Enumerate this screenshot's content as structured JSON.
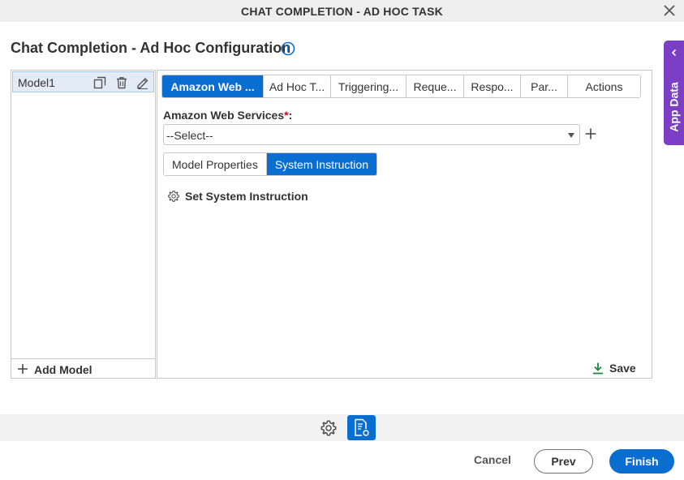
{
  "window": {
    "title": "CHAT COMPLETION - AD HOC TASK"
  },
  "page": {
    "title": "Chat Completion - Ad Hoc Configuration"
  },
  "app_data": {
    "label": "App Data"
  },
  "models": {
    "items": [
      {
        "name": "Model1"
      }
    ],
    "add_label": "Add Model"
  },
  "tabs": [
    {
      "label": "Amazon Web ...",
      "active": true
    },
    {
      "label": "Ad Hoc T...",
      "active": false
    },
    {
      "label": "Triggering...",
      "active": false
    },
    {
      "label": "Reque...",
      "active": false
    },
    {
      "label": "Respo...",
      "active": false
    },
    {
      "label": "Par...",
      "active": false
    },
    {
      "label": "Actions",
      "active": false
    }
  ],
  "aws": {
    "label": "Amazon Web Services",
    "required_mark": "*",
    "colon": ":",
    "selected": "--Select--"
  },
  "subtabs": [
    {
      "label": "Model Properties",
      "active": false
    },
    {
      "label": "System Instruction",
      "active": true
    }
  ],
  "system_instruction": {
    "link_label": "Set System Instruction"
  },
  "save_label": "Save",
  "footer": {
    "cancel_label": "Cancel",
    "prev_label": "Prev",
    "finish_label": "Finish"
  },
  "colors": {
    "primary": "#0a6ed1",
    "app_data_tab": "#7b3ec5",
    "save_icon": "#1a8a3a",
    "required": "#d0021b"
  }
}
